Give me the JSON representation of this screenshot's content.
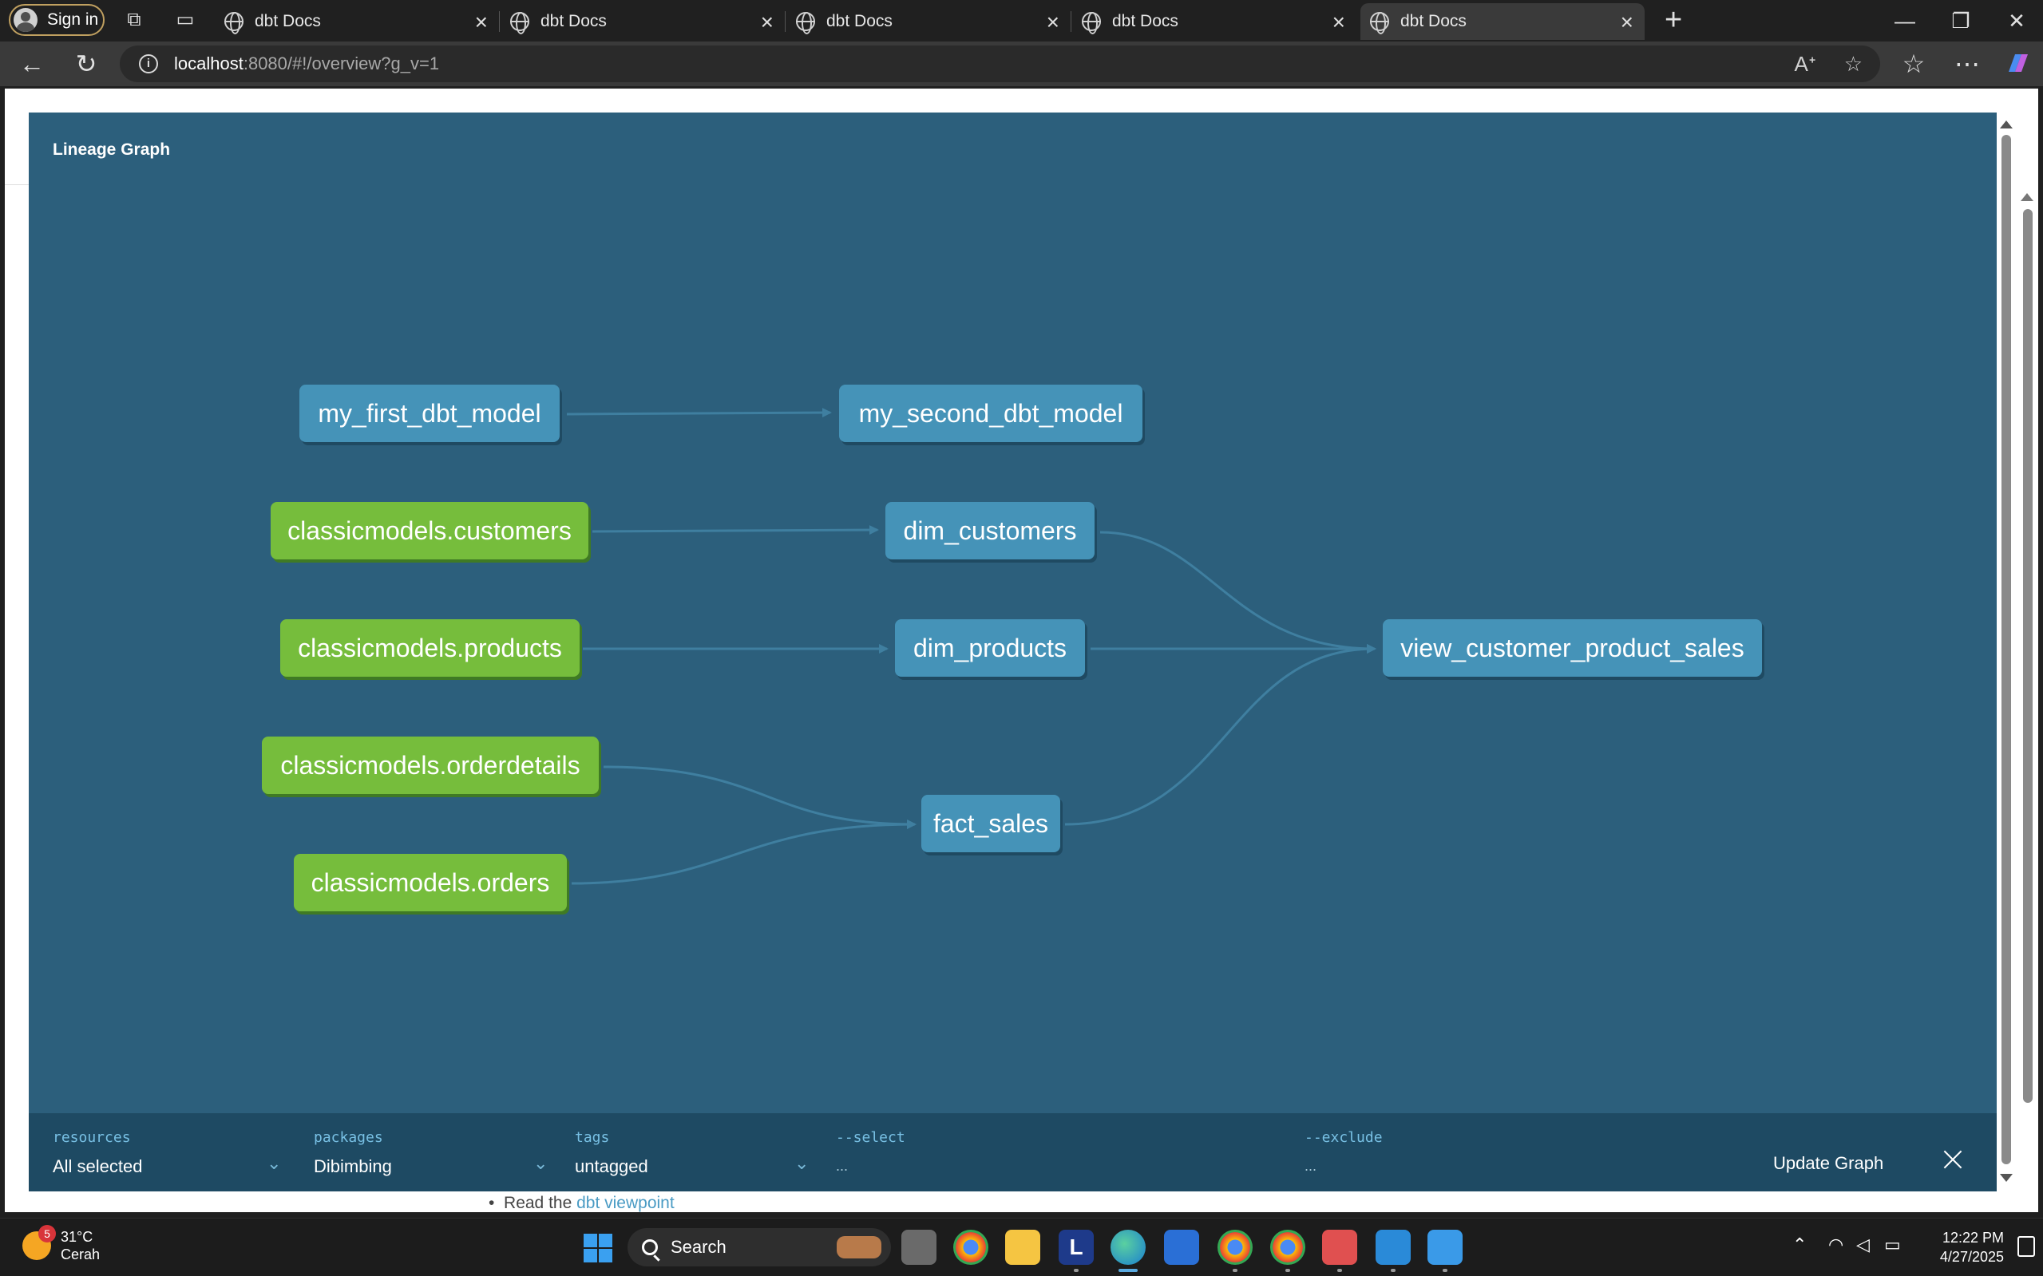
{
  "browser": {
    "signin_label": "Sign in",
    "tabs": [
      {
        "title": "dbt Docs"
      },
      {
        "title": "dbt Docs"
      },
      {
        "title": "dbt Docs"
      },
      {
        "title": "dbt Docs"
      },
      {
        "title": "dbt Docs",
        "active": true
      }
    ],
    "url_host": "localhost",
    "url_rest": ":8080/#!/overview?g_v=1"
  },
  "modal": {
    "title": "Lineage Graph",
    "nodes": {
      "my_first_dbt_model": "my_first_dbt_model",
      "my_second_dbt_model": "my_second_dbt_model",
      "src_customers": "classicmodels.customers",
      "dim_customers": "dim_customers",
      "src_products": "classicmodels.products",
      "dim_products": "dim_products",
      "view_sales": "view_customer_product_sales",
      "src_orderdetails": "classicmodels.orderdetails",
      "fact_sales": "fact_sales",
      "src_orders": "classicmodels.orders"
    },
    "colors": {
      "background": "#2c5f7c",
      "model_node": "#4593b8",
      "source_node": "#76bd3c",
      "edge": "#3f7fa0",
      "filter_bar": "#1e4a63"
    },
    "filters": {
      "resources_label": "resources",
      "resources_value": "All selected",
      "packages_label": "packages",
      "packages_value": "Dibimbing",
      "tags_label": "tags",
      "tags_value": "untagged",
      "select_label": "--select",
      "select_placeholder": "...",
      "exclude_label": "--exclude",
      "exclude_placeholder": "...",
      "update_label": "Update Graph"
    }
  },
  "page": {
    "read_prefix": "Read the",
    "read_link": "dbt viewpoint"
  },
  "taskbar": {
    "temperature": "31°C",
    "weather": "Cerah",
    "weather_badge": "5",
    "search_label": "Search",
    "time": "12:22 PM",
    "date": "4/27/2025"
  }
}
